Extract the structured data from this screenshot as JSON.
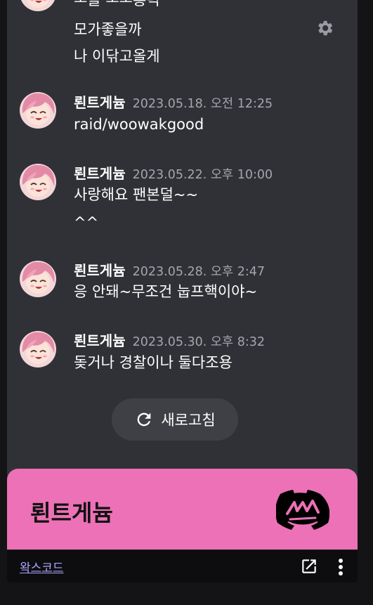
{
  "messages": {
    "group0": {
      "lines": [
        "ㅗ믈 ㅗㅗ흥녁",
        "모가좋을까",
        "나 이닦고올게"
      ]
    },
    "group1": {
      "author": "뢴트게늄",
      "timestamp": "2023.05.18. 오전 12:25",
      "lines": [
        "raid/woowakgood"
      ]
    },
    "group2": {
      "author": "뢴트게늄",
      "timestamp": "2023.05.22. 오후 10:00",
      "lines": [
        "사랑해요 팬본덜~~",
        "^^"
      ]
    },
    "group3": {
      "author": "뢴트게늄",
      "timestamp": "2023.05.28. 오후 2:47",
      "lines": [
        "응 안돼~무조건 눕프핵이야~"
      ]
    },
    "group4": {
      "author": "뢴트게늄",
      "timestamp": "2023.05.30. 오후 8:32",
      "lines": [
        "돚거나 경찰이나 둘다조용"
      ]
    }
  },
  "refresh_button": {
    "label": "새로고침",
    "icon": "refresh-icon"
  },
  "settings": {
    "icon": "gear-icon"
  },
  "banner": {
    "title": "뢴트게늄",
    "logo": "discord-logo",
    "color": "#ec71b6"
  },
  "footer": {
    "link_text": "왁스코드",
    "open_icon": "external-link-icon",
    "more_icon": "more-vertical-icon"
  }
}
